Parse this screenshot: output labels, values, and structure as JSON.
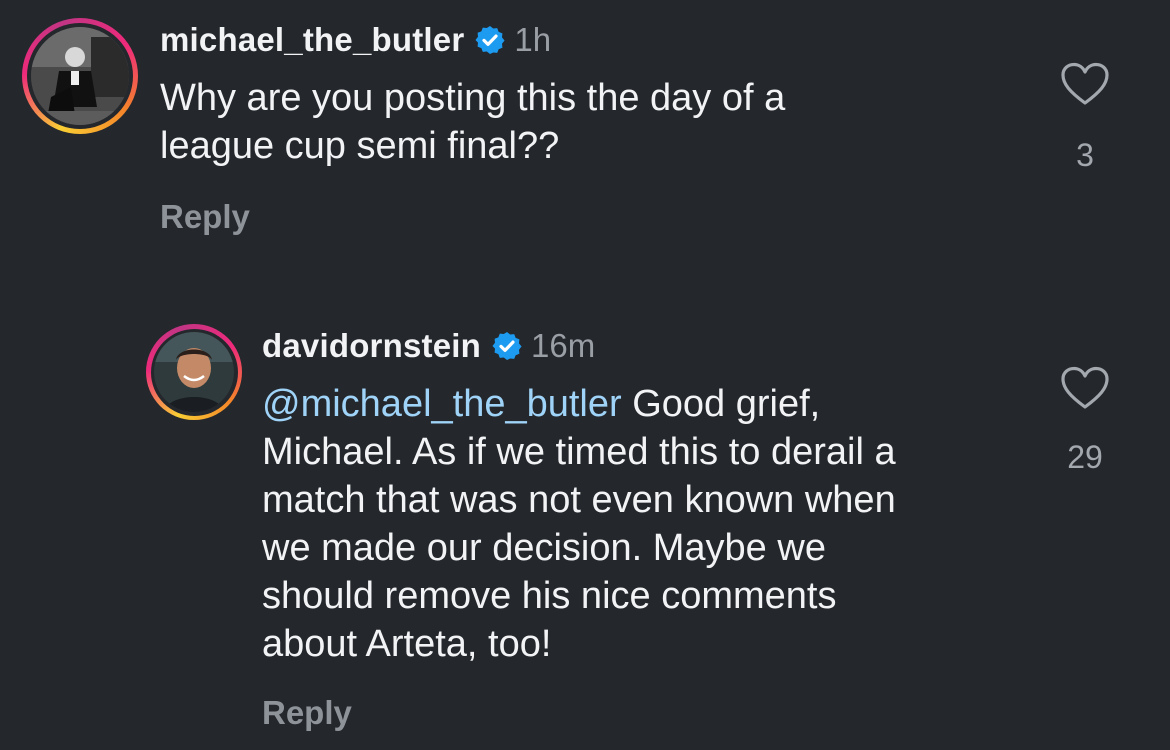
{
  "comments": [
    {
      "username": "michael_the_butler",
      "verified": true,
      "time": "1h",
      "text_lines": [
        "Why are you posting this the day of a",
        "league cup semi final??"
      ],
      "reply_label": "Reply",
      "likes": "3",
      "icons": {
        "verified": "verified-badge-icon",
        "like": "heart-icon"
      }
    },
    {
      "username": "davidornstein",
      "verified": true,
      "time": "16m",
      "mention": "@michael_the_butler",
      "text_first_line_rest": " Good grief,",
      "text_lines": [
        "Michael. As if we timed this to derail a",
        "match that was not even known when",
        "we made our decision. Maybe we",
        "should remove his nice comments",
        "about Arteta, too!"
      ],
      "reply_label": "Reply",
      "likes": "29",
      "icons": {
        "verified": "verified-badge-icon",
        "like": "heart-icon"
      }
    }
  ],
  "colors": {
    "background": "#24272c",
    "text": "#f2f3f5",
    "muted": "#9a9ea5",
    "mention": "#9fd3f7",
    "verified": "#1d9bf0"
  }
}
